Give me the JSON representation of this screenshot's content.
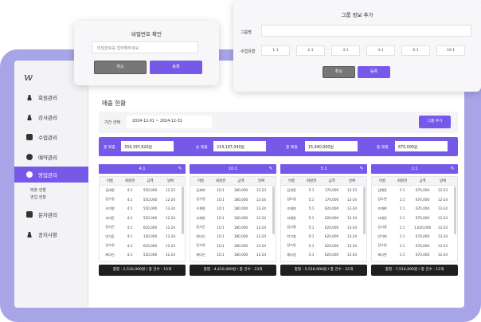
{
  "logo": "w",
  "sidebar": {
    "items": [
      {
        "label": "회원관리"
      },
      {
        "label": "강사관리"
      },
      {
        "label": "수업관리"
      },
      {
        "label": "예약관리"
      },
      {
        "label": "영업관리"
      },
      {
        "label": "문자관리"
      },
      {
        "label": "공지사항"
      }
    ],
    "sub_items": [
      "매출 현황",
      "영업 현황"
    ]
  },
  "main": {
    "title": "매출 현황",
    "filter": {
      "label": "기간 선택",
      "date_range": "2024-12-01 ~ 2024-12-31",
      "add_group_label": "그룹 추가"
    },
    "summary": [
      {
        "label": "총 매출",
        "value": "334,197,620원"
      },
      {
        "label": "순 매출",
        "value": "214,197,040원"
      },
      {
        "label": "총 매출",
        "value": "15,940,000원"
      },
      {
        "label": "등 매출",
        "value": "670,000원"
      }
    ],
    "columns": [
      "이름",
      "회원권",
      "금액",
      "날짜"
    ],
    "cards": [
      {
        "title": "4:1",
        "rows": [
          [
            "김태정",
            "4:1",
            "550,000",
            "12-23"
          ],
          [
            "김수정",
            "4:1",
            "550,000",
            "12-24"
          ],
          [
            "오미영",
            "4:1",
            "550,000",
            "12-24"
          ],
          [
            "서미란",
            "4:1",
            "550,000",
            "12-24"
          ],
          [
            "장시은",
            "4:1",
            "620,000",
            "12-24"
          ],
          [
            "안기훈",
            "4:1",
            "120,000",
            "12-24"
          ],
          [
            "강수현",
            "4:1",
            "620,000",
            "12-24"
          ],
          [
            "제다인",
            "4:1",
            "550,000",
            "12-24"
          ]
        ],
        "total": "총합 : 2,510,000원 / 총 건수 : 15개"
      },
      {
        "title": "10:1",
        "rows": [
          [
            "김제희",
            "10:1",
            "180,000",
            "12-23"
          ],
          [
            "김수정",
            "10:1",
            "180,000",
            "12-24"
          ],
          [
            "우재원",
            "10:1",
            "180,000",
            "12-24"
          ],
          [
            "서재원",
            "10:1",
            "180,000",
            "12-24"
          ],
          [
            "장시은",
            "10:1",
            "180,000",
            "12-24"
          ],
          [
            "연다은",
            "10:1",
            "180,000",
            "12-24"
          ],
          [
            "강수현",
            "10:1",
            "180,000",
            "12-24"
          ],
          [
            "제다인",
            "10:1",
            "180,000",
            "12-24"
          ]
        ],
        "total": "총합 : 4,410,000원 / 총 건수 : 23개"
      },
      {
        "title": "5:1",
        "rows": [
          [
            "김세정",
            "5:1",
            "170,000",
            "12-23"
          ],
          [
            "김도영",
            "5:1",
            "170,000",
            "12-24"
          ],
          [
            "조재영",
            "5:1",
            "620,000",
            "12-24"
          ],
          [
            "서재원",
            "5:1",
            "620,000",
            "12-24"
          ],
          [
            "김시영",
            "5:1",
            "620,000",
            "12-24"
          ],
          [
            "안기영",
            "5:1",
            "620,000",
            "12-24"
          ],
          [
            "강수현",
            "5:1",
            "620,000",
            "12-24"
          ],
          [
            "제다영",
            "5:1",
            "620,000",
            "12-24"
          ]
        ],
        "total": "총합 : 5,510,000원 / 총 건수 : 22개"
      },
      {
        "title": "1:1",
        "rows": [
          [
            "김예정",
            "1:1",
            "670,000",
            "12-23"
          ],
          [
            "김도현",
            "1:1",
            "670,000",
            "12-24"
          ],
          [
            "조재현",
            "1:1",
            "670,000",
            "12-24"
          ],
          [
            "서재현",
            "1:1",
            "670,000",
            "12-24"
          ],
          [
            "김시영",
            "1:1",
            "1,620,000",
            "12-24"
          ],
          [
            "안기현",
            "1:1",
            "670,000",
            "12-24"
          ],
          [
            "강수현",
            "1:1",
            "670,000",
            "12-24"
          ],
          [
            "제다현",
            "1:1",
            "670,000",
            "12-24"
          ]
        ],
        "total": "총합 : 7,510,000원 / 총 건수 : 12개"
      }
    ]
  },
  "password_modal": {
    "title": "비밀번호 확인",
    "placeholder": "비밀번호를 입력해주세요",
    "cancel": "취소",
    "confirm": "등록"
  },
  "group_modal": {
    "title": "그룹 정보 추가",
    "name_label": "그룹명",
    "type_label": "수업유형",
    "ratios": [
      "1:1",
      "2:1",
      "3:1",
      "4:1",
      "6:1",
      "10:1"
    ],
    "cancel": "취소",
    "confirm": "등록"
  },
  "colors": {
    "accent": "#7659e8",
    "frame": "#a8a4e8",
    "dark": "#1f1f1f"
  }
}
